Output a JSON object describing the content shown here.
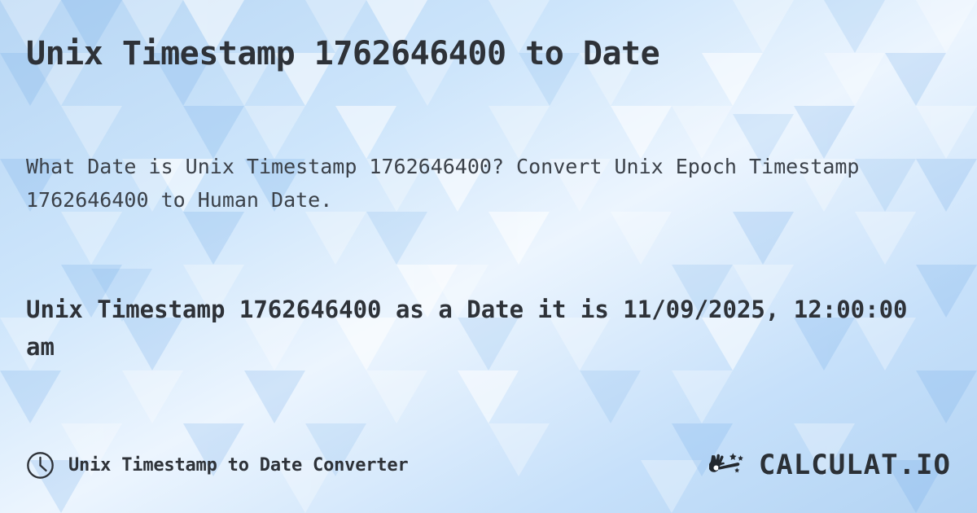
{
  "meta": {
    "background_accent": "#bcd9f5",
    "text_color": "#2e3238",
    "muted_text_color": "#3b4149"
  },
  "timestamp": "1762646400",
  "header": {
    "title": "Unix Timestamp 1762646400 to Date"
  },
  "description": {
    "text": "What Date is Unix Timestamp 1762646400? Convert Unix Epoch Timestamp 1762646400 to Human Date."
  },
  "result": {
    "text": "Unix Timestamp 1762646400 as a Date it is 11/09/2025, 12:00:00 am",
    "date_value": "11/09/2025, 12:00:00 am"
  },
  "footer": {
    "icon": "clock-icon",
    "label": "Unix Timestamp to Date Converter",
    "brand": {
      "icon": "magic-wand-hand-icon",
      "name": "CALCULAT.IO"
    }
  }
}
